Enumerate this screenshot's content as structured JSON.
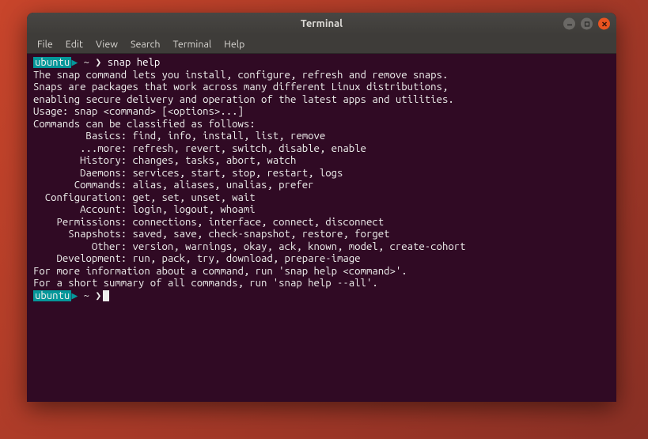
{
  "window": {
    "title": "Terminal",
    "controls": {
      "min": "–",
      "max": "□",
      "close": "×"
    }
  },
  "menubar": [
    "File",
    "Edit",
    "View",
    "Search",
    "Terminal",
    "Help"
  ],
  "prompt": {
    "host": "ubuntu",
    "path": "~"
  },
  "command": "snap help",
  "output": {
    "intro1": "The snap command lets you install, configure, refresh and remove snaps.",
    "intro2": "Snaps are packages that work across many different Linux distributions,",
    "intro3": "enabling secure delivery and operation of the latest apps and utilities.",
    "blank": "",
    "usage": "Usage: snap <command> [<options>...]",
    "classHdr": "Commands can be classified as follows:",
    "l_basics": "         Basics: find, info, install, list, remove",
    "l_more": "        ...more: refresh, revert, switch, disable, enable",
    "l_history": "        History: changes, tasks, abort, watch",
    "l_daemons": "        Daemons: services, start, stop, restart, logs",
    "l_commands": "       Commands: alias, aliases, unalias, prefer",
    "l_config": "  Configuration: get, set, unset, wait",
    "l_account": "        Account: login, logout, whoami",
    "l_perms": "    Permissions: connections, interface, connect, disconnect",
    "l_snaps": "      Snapshots: saved, save, check-snapshot, restore, forget",
    "l_other": "          Other: version, warnings, okay, ack, known, model, create-cohort",
    "l_dev": "    Development: run, pack, try, download, prepare-image",
    "foot1": "For more information about a command, run 'snap help <command>'.",
    "foot2": "For a short summary of all commands, run 'snap help --all'."
  }
}
